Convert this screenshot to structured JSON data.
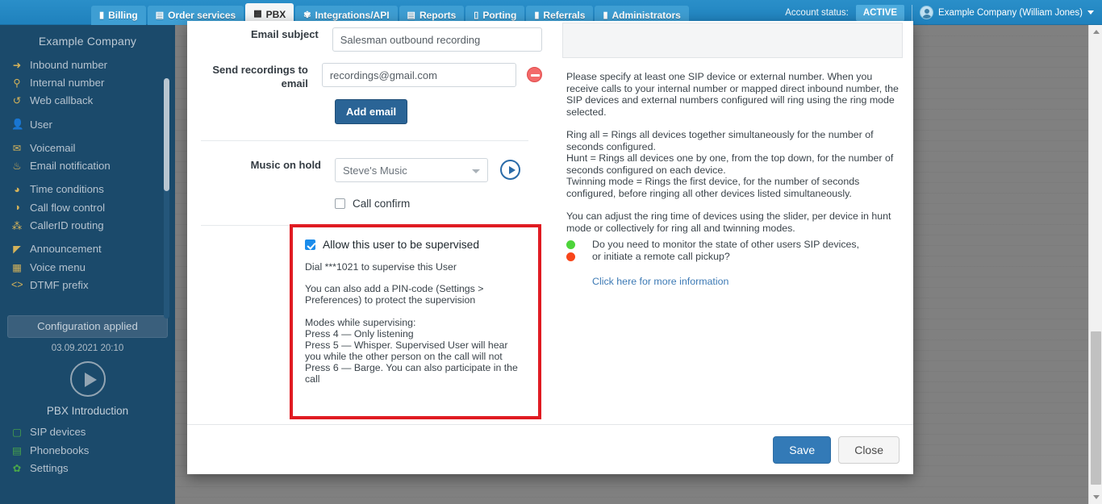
{
  "topnav": {
    "tabs": [
      {
        "label": "Billing",
        "icon": "wallet-icon",
        "glyph": "▮",
        "active": false
      },
      {
        "label": "Order services",
        "icon": "cart-icon",
        "glyph": "🛒",
        "active": false
      },
      {
        "label": "PBX",
        "icon": "pbx-icon",
        "glyph": "☰",
        "active": true
      },
      {
        "label": "Integrations/API",
        "icon": "gear-icon",
        "glyph": "⚙",
        "active": false
      },
      {
        "label": "Reports",
        "icon": "report-icon",
        "glyph": "▤",
        "active": false
      },
      {
        "label": "Porting",
        "icon": "phone-icon",
        "glyph": "▯",
        "active": false
      },
      {
        "label": "Referrals",
        "icon": "lock-icon",
        "glyph": "🔒",
        "active": false
      },
      {
        "label": "Administrators",
        "icon": "person-icon",
        "glyph": "👤",
        "active": false
      }
    ],
    "account_status_label": "Account status:",
    "account_status_value": "ACTIVE",
    "user_name": "Example Company (William Jones)",
    "accent_color": "#1f81bd",
    "status_color": "#4dabdd"
  },
  "sidebar": {
    "title": "Example Company",
    "items": [
      {
        "label": "Inbound number",
        "icon": "arrow-right-circle-icon",
        "glyph": "➜"
      },
      {
        "label": "Internal number",
        "icon": "map-pin-icon",
        "glyph": "⚲"
      },
      {
        "label": "Web callback",
        "icon": "undo-icon",
        "glyph": "↺"
      },
      {
        "label": "User",
        "icon": "user-icon",
        "glyph": "👤"
      },
      {
        "label": "Voicemail",
        "icon": "envelope-icon",
        "glyph": "✉"
      },
      {
        "label": "Email notification",
        "icon": "bell-icon",
        "glyph": "🔔"
      },
      {
        "label": "Time conditions",
        "icon": "clock-icon",
        "glyph": "◕"
      },
      {
        "label": "Call flow control",
        "icon": "toggle-icon",
        "glyph": "◑"
      },
      {
        "label": "CallerID routing",
        "icon": "sitemap-icon",
        "glyph": "⁂"
      },
      {
        "label": "Announcement",
        "icon": "megaphone-icon",
        "glyph": "◣"
      },
      {
        "label": "Voice menu",
        "icon": "grid-icon",
        "glyph": "▦"
      },
      {
        "label": "DTMF prefix",
        "icon": "code-icon",
        "glyph": "‹›"
      }
    ],
    "config_button": "Configuration applied",
    "config_time": "03.09.2021 20:10",
    "intro_label": "PBX Introduction",
    "bottom_items": [
      {
        "label": "SIP devices",
        "icon": "monitor-icon",
        "glyph": "▢"
      },
      {
        "label": "Phonebooks",
        "icon": "book-icon",
        "glyph": "▤"
      },
      {
        "label": "Settings",
        "icon": "gear-icon",
        "glyph": "✿"
      }
    ],
    "background_color": "#1b4a6b"
  },
  "form": {
    "email_subject_label": "Email subject",
    "email_subject_value": "Salesman outbound recording",
    "send_recordings_label_line1": "Send recordings to",
    "send_recordings_label_line2": "email",
    "send_recordings_value": "recordings@gmail.com",
    "add_email_button": "Add email",
    "music_on_hold_label": "Music on hold",
    "music_on_hold_value": "Steve's Music",
    "call_confirm_label": "Call confirm",
    "call_confirm_checked": false
  },
  "supervision": {
    "checkbox_label": "Allow this user to be supervised",
    "checked": true,
    "dial_text": "Dial ***1021 to supervise this User",
    "pin_text": "You can also add a PIN-code (Settings > Preferences) to protect the supervision",
    "modes_heading": "Modes while supervising:",
    "mode_4": "Press 4 — Only listening",
    "mode_5": "Press 5 — Whisper. Supervised User will hear you while the other person on the call will not",
    "mode_6": "Press 6 — Barge. You can also participate in the call",
    "highlight_color": "#e01b22"
  },
  "info": {
    "para1": "Please specify at least one SIP device or external number. When you receive calls to your internal number or mapped direct inbound number, the SIP devices and external numbers configured will ring using the ring mode selected.",
    "para2_line1": "Ring all = Rings all devices together simultaneously for the number of seconds configured.",
    "para2_line2": "Hunt = Rings all devices one by one, from the top down, for the number of seconds configured on each device.",
    "para2_line3": "Twinning mode = Rings the first device, for the number of seconds configured, before ringing all other devices listed simultaneously.",
    "para3": "You can adjust the ring time of devices using the slider, per device in hunt mode or collectively for ring all and twinning modes.",
    "monitor_line1": "Do you need to monitor the state of other users SIP devices,",
    "monitor_line2": "or initiate a remote call pickup?",
    "link_text": "Click here for more information",
    "green_dot_color": "#4dd43a",
    "red_dot_color": "#f8451a",
    "link_color": "#3d7ab5"
  },
  "footer": {
    "save_label": "Save",
    "close_label": "Close"
  }
}
